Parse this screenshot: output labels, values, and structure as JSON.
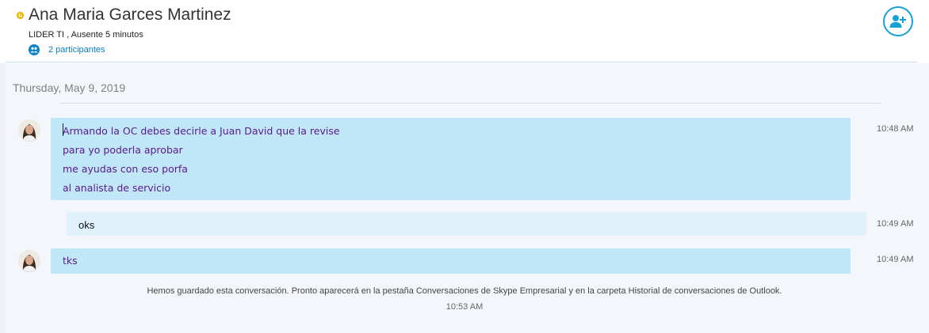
{
  "conversation": {
    "contact_name": "Ana Maria Garces Martinez",
    "status_line": "LIDER TI ,  Ausente 5 minutos",
    "participants_label": "2 participantes",
    "presence_icon": "away-clock-icon",
    "add_person_icon": "add-person-icon",
    "accent_color": "#15a1d6",
    "presence_color": "#f4c418"
  },
  "date_separator": "Thursday, May 9, 2019",
  "messages": [
    {
      "direction": "incoming",
      "lines": [
        "Armando la OC debes decirle a Juan David que la revise",
        "para yo poderla aprobar",
        "me ayudas con eso porfa",
        "al analista de servicio"
      ],
      "time": "10:48 AM"
    },
    {
      "direction": "outgoing",
      "lines": [
        "oks"
      ],
      "time": "10:49 AM"
    },
    {
      "direction": "incoming",
      "lines": [
        "tks"
      ],
      "time": "10:49 AM"
    }
  ],
  "footer": {
    "saved_note": "Hemos guardado esta conversación. Pronto aparecerá en la pestaña Conversaciones de Skype Empresarial y en la carpeta Historial de conversaciones de Outlook.",
    "saved_time": "10:53 AM"
  }
}
